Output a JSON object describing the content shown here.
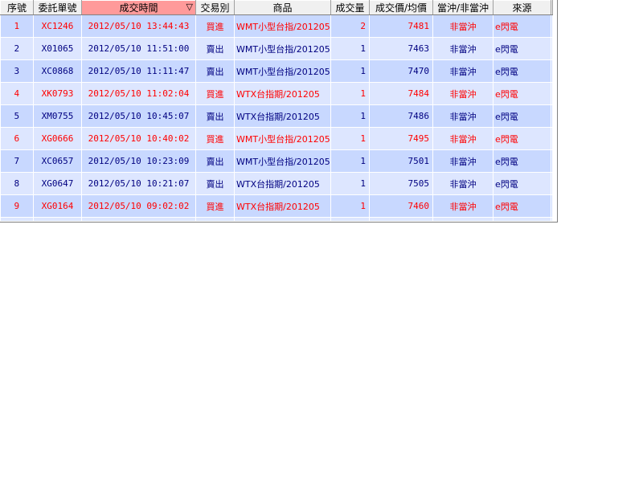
{
  "columns": {
    "seq": "序號",
    "order_no": "委託單號",
    "trade_time": "成交時間",
    "side": "交易別",
    "product": "商品",
    "qty": "成交量",
    "price": "成交價/均價",
    "offset": "當沖/非當沖",
    "source": "來源"
  },
  "sort": {
    "column": "trade_time",
    "indicator": "▽"
  },
  "rows": [
    {
      "seq": "1",
      "order_no": "XC1246",
      "time": "2012/05/10 13:44:43",
      "side": "買進",
      "product": "WMT小型台指/201205",
      "qty": "2",
      "price": "7481",
      "offset": "非當沖",
      "source": "e閃電"
    },
    {
      "seq": "2",
      "order_no": "X01065",
      "time": "2012/05/10 11:51:00",
      "side": "賣出",
      "product": "WMT小型台指/201205",
      "qty": "1",
      "price": "7463",
      "offset": "非當沖",
      "source": "e閃電"
    },
    {
      "seq": "3",
      "order_no": "XC0868",
      "time": "2012/05/10 11:11:47",
      "side": "賣出",
      "product": "WMT小型台指/201205",
      "qty": "1",
      "price": "7470",
      "offset": "非當沖",
      "source": "e閃電"
    },
    {
      "seq": "4",
      "order_no": "XK0793",
      "time": "2012/05/10 11:02:04",
      "side": "買進",
      "product": "WTX台指期/201205",
      "qty": "1",
      "price": "7484",
      "offset": "非當沖",
      "source": "e閃電"
    },
    {
      "seq": "5",
      "order_no": "XM0755",
      "time": "2012/05/10 10:45:07",
      "side": "賣出",
      "product": "WTX台指期/201205",
      "qty": "1",
      "price": "7486",
      "offset": "非當沖",
      "source": "e閃電"
    },
    {
      "seq": "6",
      "order_no": "XG0666",
      "time": "2012/05/10 10:40:02",
      "side": "買進",
      "product": "WMT小型台指/201205",
      "qty": "1",
      "price": "7495",
      "offset": "非當沖",
      "source": "e閃電"
    },
    {
      "seq": "7",
      "order_no": "XC0657",
      "time": "2012/05/10 10:23:09",
      "side": "賣出",
      "product": "WMT小型台指/201205",
      "qty": "1",
      "price": "7501",
      "offset": "非當沖",
      "source": "e閃電"
    },
    {
      "seq": "8",
      "order_no": "XG0647",
      "time": "2012/05/10 10:21:07",
      "side": "賣出",
      "product": "WTX台指期/201205",
      "qty": "1",
      "price": "7505",
      "offset": "非當沖",
      "source": "e閃電"
    },
    {
      "seq": "9",
      "order_no": "XG0164",
      "time": "2012/05/10 09:02:02",
      "side": "買進",
      "product": "WTX台指期/201205",
      "qty": "1",
      "price": "7460",
      "offset": "非當沖",
      "source": "e閃電"
    }
  ],
  "colors": {
    "buy_text": "#ff0000",
    "sell_text": "#000080",
    "row_alt_a": "#c8d8ff",
    "row_alt_b": "#dde6ff",
    "sorted_header": "#ff9a9a"
  }
}
